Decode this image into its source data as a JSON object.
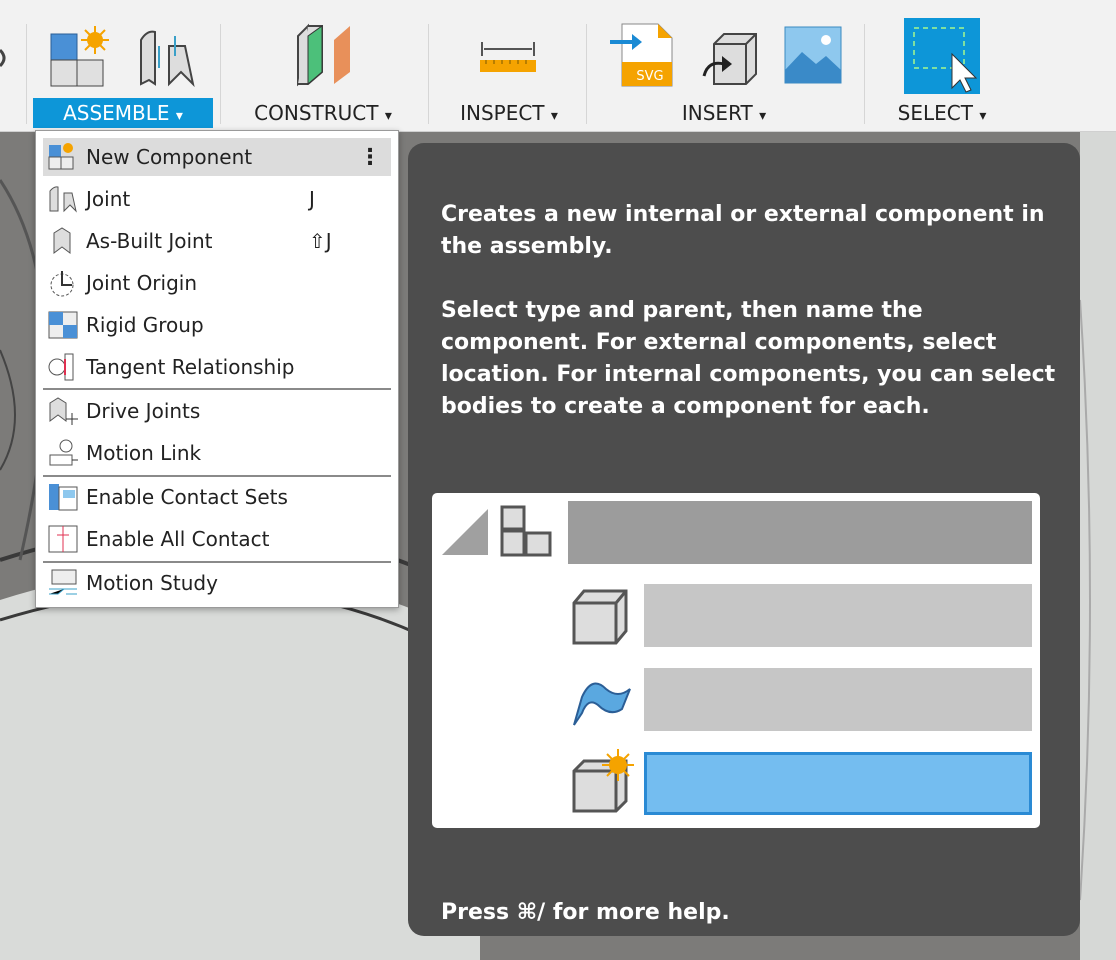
{
  "toolbar": {
    "groups": [
      {
        "label": "ASSEMBLE",
        "active": true
      },
      {
        "label": "CONSTRUCT",
        "active": false
      },
      {
        "label": "INSPECT",
        "active": false
      },
      {
        "label": "INSERT",
        "active": false
      },
      {
        "label": "SELECT",
        "active": false
      }
    ],
    "dropdown_arrow": "▾"
  },
  "menu": {
    "items": [
      {
        "label": "New Component",
        "icon": "new-component-icon",
        "shortcut": "",
        "more": "⋮"
      },
      {
        "label": "Joint",
        "icon": "joint-icon",
        "shortcut": "J"
      },
      {
        "label": "As-Built Joint",
        "icon": "as-built-joint-icon",
        "shortcut": "⇧J"
      },
      {
        "label": "Joint Origin",
        "icon": "joint-origin-icon",
        "shortcut": ""
      },
      {
        "label": "Rigid Group",
        "icon": "rigid-group-icon",
        "shortcut": ""
      },
      {
        "label": "Tangent Relationship",
        "icon": "tangent-relationship-icon",
        "shortcut": ""
      },
      {
        "label": "Drive Joints",
        "icon": "drive-joints-icon",
        "shortcut": ""
      },
      {
        "label": "Motion Link",
        "icon": "motion-link-icon",
        "shortcut": ""
      },
      {
        "label": "Enable Contact Sets",
        "icon": "enable-contact-sets-icon",
        "shortcut": ""
      },
      {
        "label": "Enable All Contact",
        "icon": "enable-all-contact-icon",
        "shortcut": ""
      },
      {
        "label": "Motion Study",
        "icon": "motion-study-icon",
        "shortcut": ""
      }
    ]
  },
  "tooltip": {
    "description": "Creates a new internal or external component in the assembly.",
    "details": "Select type and parent, then name the component. For external components, select location. For internal components, you can select bodies to create a component for each.",
    "help": "Press ⌘/ for more help."
  },
  "colors": {
    "accent": "#0d96d8",
    "tooltip_bg": "#4d4d4d",
    "highlight": "#74bdf0"
  }
}
